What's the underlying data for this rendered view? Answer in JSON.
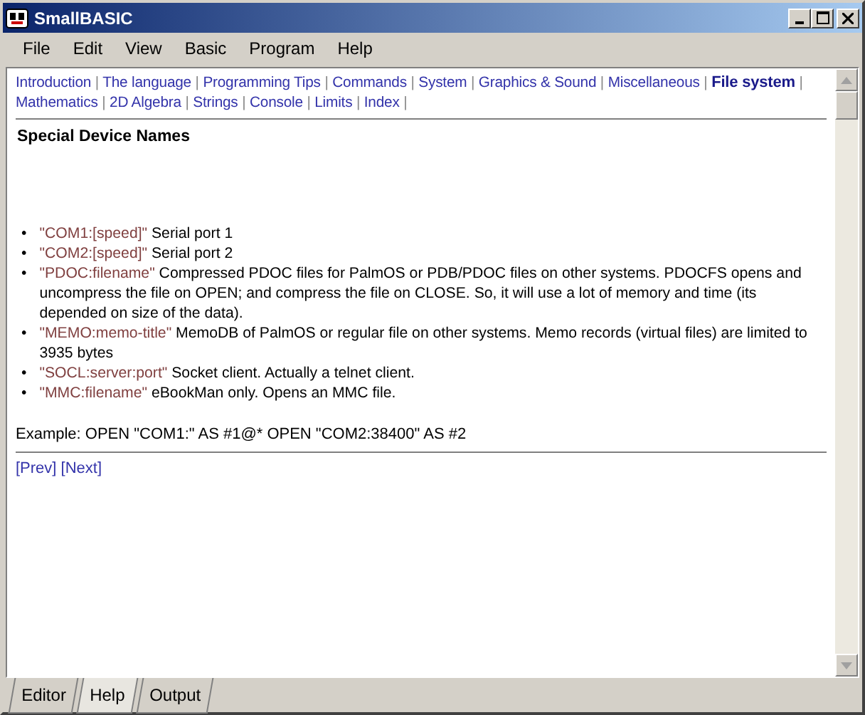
{
  "window": {
    "title": "SmallBASIC"
  },
  "menu": [
    "File",
    "Edit",
    "View",
    "Basic",
    "Program",
    "Help"
  ],
  "nav_links": [
    {
      "label": "Introduction",
      "separator": "|",
      "selected": false
    },
    {
      "label": "The language",
      "separator": "|",
      "selected": false
    },
    {
      "label": "Programming Tips",
      "separator": "|",
      "selected": false
    },
    {
      "label": "Commands",
      "separator": "|",
      "selected": false
    },
    {
      "label": "System",
      "separator": "|",
      "selected": false
    },
    {
      "label": "Graphics & Sound",
      "separator": "|",
      "selected": false
    },
    {
      "label": "Miscellaneous",
      "separator": "|",
      "selected": false
    },
    {
      "label": "File system",
      "separator": "|",
      "selected": true
    },
    {
      "label": "Mathematics",
      "separator": "|",
      "selected": false
    },
    {
      "label": "2D Algebra",
      "separator": "|",
      "selected": false
    },
    {
      "label": "Strings",
      "separator": "|",
      "selected": false
    },
    {
      "label": "Console",
      "separator": "|",
      "selected": false
    },
    {
      "label": "Limits",
      "separator": "|",
      "selected": false
    },
    {
      "label": "Index",
      "separator": "|",
      "selected": false
    }
  ],
  "heading": "Special Device Names",
  "items": [
    {
      "bullet": "•",
      "term": "\"COM1:[speed]\"",
      "description": "Serial port 1"
    },
    {
      "bullet": "•",
      "term": "\"COM2:[speed]\"",
      "description": "Serial port 2"
    },
    {
      "bullet": "•",
      "term": "\"PDOC:filename\"",
      "description": "Compressed PDOC files for PalmOS or PDB/PDOC files on other systems. PDOCFS opens and uncompress the file on OPEN; and compress the file on CLOSE. So, it will use a lot of memory and time (its depended on size of the data)."
    },
    {
      "bullet": "•",
      "term": "\"MEMO:memo-title\"",
      "description": "MemoDB of PalmOS or regular file on other systems. Memo records (virtual files) are limited to 3935 bytes"
    },
    {
      "bullet": "•",
      "term": "\"SOCL:server:port\"",
      "description": "Socket client. Actually a telnet client."
    },
    {
      "bullet": "•",
      "term": "\"MMC:filename\"",
      "description": "eBookMan only. Opens an MMC file."
    }
  ],
  "example": "Example: OPEN \"COM1:\" AS #1@* OPEN \"COM2:38400\" AS #2",
  "pager": [
    "[Prev]",
    "[Next]"
  ],
  "tabs": [
    {
      "label": "Editor",
      "selected": false
    },
    {
      "label": "Help",
      "selected": true
    },
    {
      "label": "Output",
      "selected": false
    }
  ]
}
